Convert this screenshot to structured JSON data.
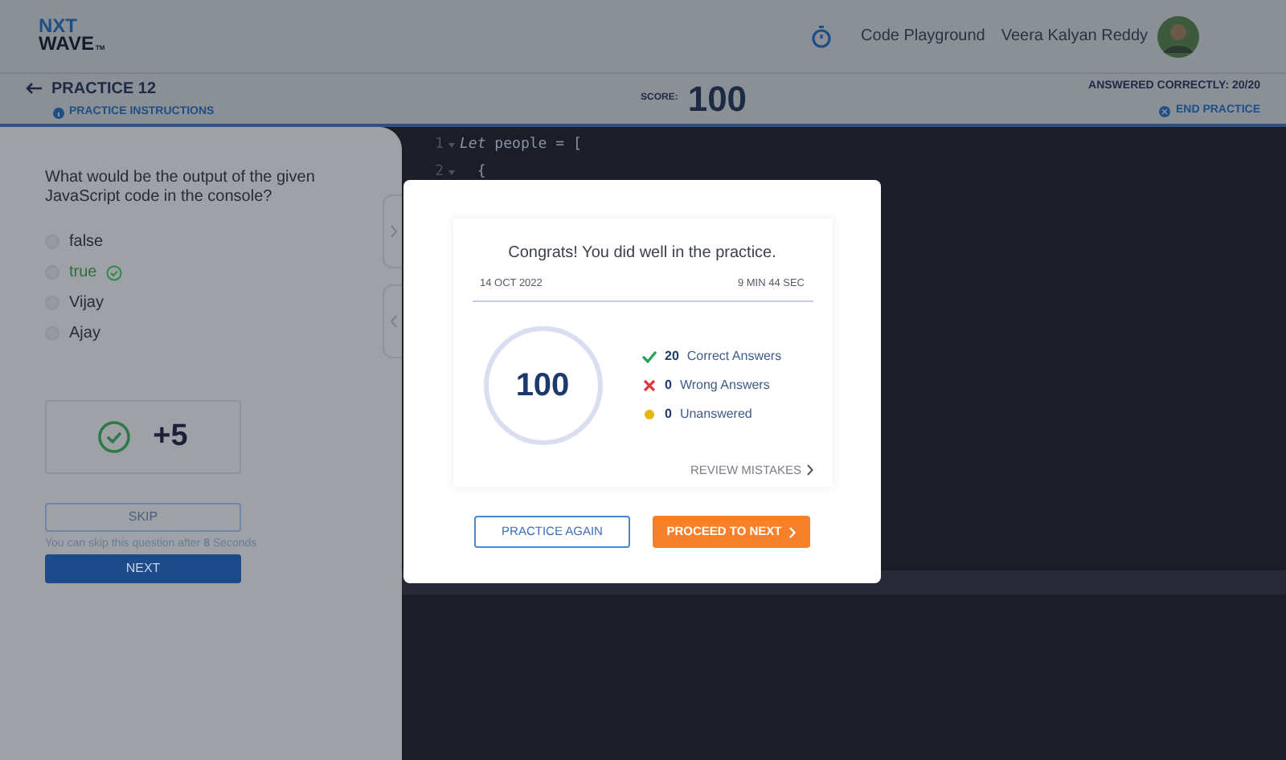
{
  "header": {
    "logo": {
      "top": "NXT",
      "bottom": "WAVE",
      "mark": "TM"
    },
    "link": "Code Playground",
    "user": "Veera Kalyan Reddy"
  },
  "practice_bar": {
    "title": "PRACTICE 12",
    "instructions": "PRACTICE INSTRUCTIONS",
    "score_label": "SCORE:",
    "score": "100",
    "answered": "ANSWERED CORRECTLY: 20/20",
    "end": "END PRACTICE"
  },
  "question": {
    "text": "What would be the output of the given JavaScript code in the console?",
    "options": [
      {
        "label": "false",
        "correct": false,
        "selected": false
      },
      {
        "label": "true",
        "correct": true,
        "selected": false
      },
      {
        "label": "Vijay",
        "correct": false,
        "selected": false
      },
      {
        "label": "Ajay",
        "correct": false,
        "selected": false
      }
    ],
    "points": "+5",
    "skip": {
      "label": "SKIP",
      "disabled": true
    },
    "skip_note": "You can skip this question after **8** Seconds",
    "next": "NEXT"
  },
  "code_lines": [
    {
      "number": "1",
      "text": "*Let* people = ["
    },
    {
      "number": "2",
      "text": "  {"
    }
  ],
  "result_modal": {
    "title": "Congrats! You did well in the practice.",
    "date": "14 OCT 2022",
    "duration": "9 MIN 44 SEC",
    "score": "100",
    "stats": [
      {
        "kind": "correct",
        "count": "20",
        "label": "Correct Answers"
      },
      {
        "kind": "wrong",
        "count": "0",
        "label": "Wrong Answers"
      },
      {
        "kind": "unanswered",
        "count": "0",
        "label": "Unanswered"
      }
    ],
    "review": "REVIEW MISTAKES",
    "buttons": {
      "again": "PRACTICE AGAIN",
      "next": "PROCEED TO NEXT"
    }
  }
}
